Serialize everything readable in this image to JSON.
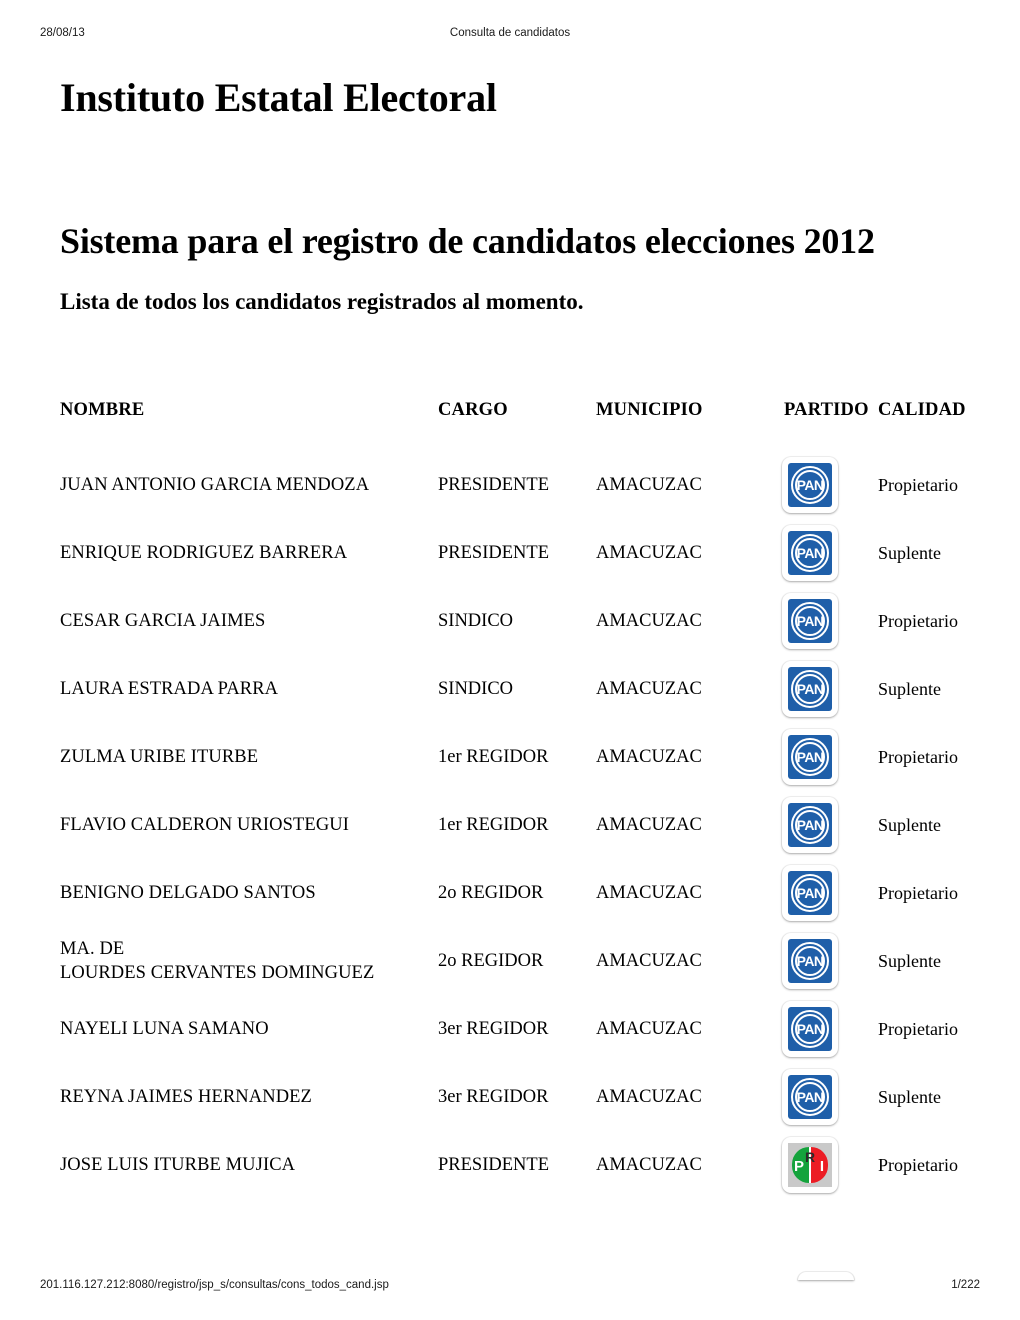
{
  "page_header": {
    "date": "28/08/13",
    "title": "Consulta de candidatos"
  },
  "page_footer": {
    "url": "201.116.127.212:8080/registro/jsp_s/consultas/cons_todos_cand.jsp",
    "page_number": "1/222"
  },
  "document": {
    "org_title": "Instituto Estatal Electoral",
    "system_title": "Sistema para el registro de candidatos elecciones 2012",
    "subtitle": "Lista de todos los candidatos registrados al momento."
  },
  "table": {
    "headers": {
      "nombre": "NOMBRE",
      "cargo": "CARGO",
      "municipio": "MUNICIPIO",
      "partido": "PARTIDO",
      "calidad": "CALIDAD"
    },
    "rows": [
      {
        "nombre": "JUAN ANTONIO GARCIA MENDOZA",
        "nombre_line2": "",
        "cargo": "PRESIDENTE",
        "municipio": "AMACUZAC",
        "partido": "PAN",
        "calidad": "Propietario"
      },
      {
        "nombre": "ENRIQUE RODRIGUEZ BARRERA",
        "nombre_line2": "",
        "cargo": "PRESIDENTE",
        "municipio": "AMACUZAC",
        "partido": "PAN",
        "calidad": "Suplente"
      },
      {
        "nombre": "CESAR GARCIA JAIMES",
        "nombre_line2": "",
        "cargo": "SINDICO",
        "municipio": "AMACUZAC",
        "partido": "PAN",
        "calidad": "Propietario"
      },
      {
        "nombre": "LAURA ESTRADA PARRA",
        "nombre_line2": "",
        "cargo": "SINDICO",
        "municipio": "AMACUZAC",
        "partido": "PAN",
        "calidad": "Suplente"
      },
      {
        "nombre": "ZULMA URIBE ITURBE",
        "nombre_line2": "",
        "cargo": "1er REGIDOR",
        "municipio": "AMACUZAC",
        "partido": "PAN",
        "calidad": "Propietario"
      },
      {
        "nombre": "FLAVIO CALDERON URIOSTEGUI",
        "nombre_line2": "",
        "cargo": "1er REGIDOR",
        "municipio": "AMACUZAC",
        "partido": "PAN",
        "calidad": "Suplente"
      },
      {
        "nombre": "BENIGNO DELGADO SANTOS",
        "nombre_line2": "",
        "cargo": "2o REGIDOR",
        "municipio": "AMACUZAC",
        "partido": "PAN",
        "calidad": "Propietario"
      },
      {
        "nombre": "MA. DE",
        "nombre_line2": "LOURDES CERVANTES DOMINGUEZ",
        "cargo": "2o REGIDOR",
        "municipio": "AMACUZAC",
        "partido": "PAN",
        "calidad": "Suplente"
      },
      {
        "nombre": "NAYELI LUNA SAMANO",
        "nombre_line2": "",
        "cargo": "3er REGIDOR",
        "municipio": "AMACUZAC",
        "partido": "PAN",
        "calidad": "Propietario"
      },
      {
        "nombre": "REYNA JAIMES HERNANDEZ",
        "nombre_line2": "",
        "cargo": "3er REGIDOR",
        "municipio": "AMACUZAC",
        "partido": "PAN",
        "calidad": "Suplente"
      },
      {
        "nombre": "JOSE LUIS ITURBE MUJICA",
        "nombre_line2": "",
        "cargo": "PRESIDENTE",
        "municipio": "AMACUZAC",
        "partido": "PRI",
        "calidad": "Propietario"
      }
    ]
  },
  "logos": {
    "pan": {
      "text": "PAN",
      "color": "#1f5fa9"
    },
    "pri": {
      "letter_p": "P",
      "letter_r": "R",
      "letter_i": "I",
      "green": "#14a33c",
      "red": "#ec1c24",
      "background": "#c9c9c9"
    }
  }
}
